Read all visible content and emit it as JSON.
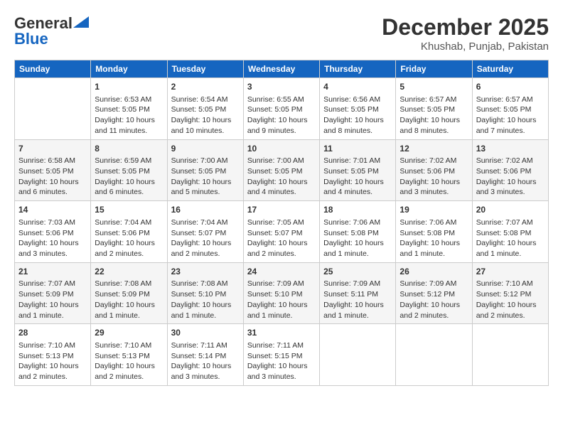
{
  "header": {
    "logo_general": "General",
    "logo_blue": "Blue",
    "month": "December 2025",
    "location": "Khushab, Punjab, Pakistan"
  },
  "days_of_week": [
    "Sunday",
    "Monday",
    "Tuesday",
    "Wednesday",
    "Thursday",
    "Friday",
    "Saturday"
  ],
  "weeks": [
    [
      {
        "day": "",
        "sunrise": "",
        "sunset": "",
        "daylight": "",
        "empty": true
      },
      {
        "day": "1",
        "sunrise": "Sunrise: 6:53 AM",
        "sunset": "Sunset: 5:05 PM",
        "daylight": "Daylight: 10 hours and 11 minutes.",
        "empty": false
      },
      {
        "day": "2",
        "sunrise": "Sunrise: 6:54 AM",
        "sunset": "Sunset: 5:05 PM",
        "daylight": "Daylight: 10 hours and 10 minutes.",
        "empty": false
      },
      {
        "day": "3",
        "sunrise": "Sunrise: 6:55 AM",
        "sunset": "Sunset: 5:05 PM",
        "daylight": "Daylight: 10 hours and 9 minutes.",
        "empty": false
      },
      {
        "day": "4",
        "sunrise": "Sunrise: 6:56 AM",
        "sunset": "Sunset: 5:05 PM",
        "daylight": "Daylight: 10 hours and 8 minutes.",
        "empty": false
      },
      {
        "day": "5",
        "sunrise": "Sunrise: 6:57 AM",
        "sunset": "Sunset: 5:05 PM",
        "daylight": "Daylight: 10 hours and 8 minutes.",
        "empty": false
      },
      {
        "day": "6",
        "sunrise": "Sunrise: 6:57 AM",
        "sunset": "Sunset: 5:05 PM",
        "daylight": "Daylight: 10 hours and 7 minutes.",
        "empty": false
      }
    ],
    [
      {
        "day": "7",
        "sunrise": "Sunrise: 6:58 AM",
        "sunset": "Sunset: 5:05 PM",
        "daylight": "Daylight: 10 hours and 6 minutes.",
        "empty": false
      },
      {
        "day": "8",
        "sunrise": "Sunrise: 6:59 AM",
        "sunset": "Sunset: 5:05 PM",
        "daylight": "Daylight: 10 hours and 6 minutes.",
        "empty": false
      },
      {
        "day": "9",
        "sunrise": "Sunrise: 7:00 AM",
        "sunset": "Sunset: 5:05 PM",
        "daylight": "Daylight: 10 hours and 5 minutes.",
        "empty": false
      },
      {
        "day": "10",
        "sunrise": "Sunrise: 7:00 AM",
        "sunset": "Sunset: 5:05 PM",
        "daylight": "Daylight: 10 hours and 4 minutes.",
        "empty": false
      },
      {
        "day": "11",
        "sunrise": "Sunrise: 7:01 AM",
        "sunset": "Sunset: 5:05 PM",
        "daylight": "Daylight: 10 hours and 4 minutes.",
        "empty": false
      },
      {
        "day": "12",
        "sunrise": "Sunrise: 7:02 AM",
        "sunset": "Sunset: 5:06 PM",
        "daylight": "Daylight: 10 hours and 3 minutes.",
        "empty": false
      },
      {
        "day": "13",
        "sunrise": "Sunrise: 7:02 AM",
        "sunset": "Sunset: 5:06 PM",
        "daylight": "Daylight: 10 hours and 3 minutes.",
        "empty": false
      }
    ],
    [
      {
        "day": "14",
        "sunrise": "Sunrise: 7:03 AM",
        "sunset": "Sunset: 5:06 PM",
        "daylight": "Daylight: 10 hours and 3 minutes.",
        "empty": false
      },
      {
        "day": "15",
        "sunrise": "Sunrise: 7:04 AM",
        "sunset": "Sunset: 5:06 PM",
        "daylight": "Daylight: 10 hours and 2 minutes.",
        "empty": false
      },
      {
        "day": "16",
        "sunrise": "Sunrise: 7:04 AM",
        "sunset": "Sunset: 5:07 PM",
        "daylight": "Daylight: 10 hours and 2 minutes.",
        "empty": false
      },
      {
        "day": "17",
        "sunrise": "Sunrise: 7:05 AM",
        "sunset": "Sunset: 5:07 PM",
        "daylight": "Daylight: 10 hours and 2 minutes.",
        "empty": false
      },
      {
        "day": "18",
        "sunrise": "Sunrise: 7:06 AM",
        "sunset": "Sunset: 5:08 PM",
        "daylight": "Daylight: 10 hours and 1 minute.",
        "empty": false
      },
      {
        "day": "19",
        "sunrise": "Sunrise: 7:06 AM",
        "sunset": "Sunset: 5:08 PM",
        "daylight": "Daylight: 10 hours and 1 minute.",
        "empty": false
      },
      {
        "day": "20",
        "sunrise": "Sunrise: 7:07 AM",
        "sunset": "Sunset: 5:08 PM",
        "daylight": "Daylight: 10 hours and 1 minute.",
        "empty": false
      }
    ],
    [
      {
        "day": "21",
        "sunrise": "Sunrise: 7:07 AM",
        "sunset": "Sunset: 5:09 PM",
        "daylight": "Daylight: 10 hours and 1 minute.",
        "empty": false
      },
      {
        "day": "22",
        "sunrise": "Sunrise: 7:08 AM",
        "sunset": "Sunset: 5:09 PM",
        "daylight": "Daylight: 10 hours and 1 minute.",
        "empty": false
      },
      {
        "day": "23",
        "sunrise": "Sunrise: 7:08 AM",
        "sunset": "Sunset: 5:10 PM",
        "daylight": "Daylight: 10 hours and 1 minute.",
        "empty": false
      },
      {
        "day": "24",
        "sunrise": "Sunrise: 7:09 AM",
        "sunset": "Sunset: 5:10 PM",
        "daylight": "Daylight: 10 hours and 1 minute.",
        "empty": false
      },
      {
        "day": "25",
        "sunrise": "Sunrise: 7:09 AM",
        "sunset": "Sunset: 5:11 PM",
        "daylight": "Daylight: 10 hours and 1 minute.",
        "empty": false
      },
      {
        "day": "26",
        "sunrise": "Sunrise: 7:09 AM",
        "sunset": "Sunset: 5:12 PM",
        "daylight": "Daylight: 10 hours and 2 minutes.",
        "empty": false
      },
      {
        "day": "27",
        "sunrise": "Sunrise: 7:10 AM",
        "sunset": "Sunset: 5:12 PM",
        "daylight": "Daylight: 10 hours and 2 minutes.",
        "empty": false
      }
    ],
    [
      {
        "day": "28",
        "sunrise": "Sunrise: 7:10 AM",
        "sunset": "Sunset: 5:13 PM",
        "daylight": "Daylight: 10 hours and 2 minutes.",
        "empty": false
      },
      {
        "day": "29",
        "sunrise": "Sunrise: 7:10 AM",
        "sunset": "Sunset: 5:13 PM",
        "daylight": "Daylight: 10 hours and 2 minutes.",
        "empty": false
      },
      {
        "day": "30",
        "sunrise": "Sunrise: 7:11 AM",
        "sunset": "Sunset: 5:14 PM",
        "daylight": "Daylight: 10 hours and 3 minutes.",
        "empty": false
      },
      {
        "day": "31",
        "sunrise": "Sunrise: 7:11 AM",
        "sunset": "Sunset: 5:15 PM",
        "daylight": "Daylight: 10 hours and 3 minutes.",
        "empty": false
      },
      {
        "day": "",
        "sunrise": "",
        "sunset": "",
        "daylight": "",
        "empty": true
      },
      {
        "day": "",
        "sunrise": "",
        "sunset": "",
        "daylight": "",
        "empty": true
      },
      {
        "day": "",
        "sunrise": "",
        "sunset": "",
        "daylight": "",
        "empty": true
      }
    ]
  ]
}
